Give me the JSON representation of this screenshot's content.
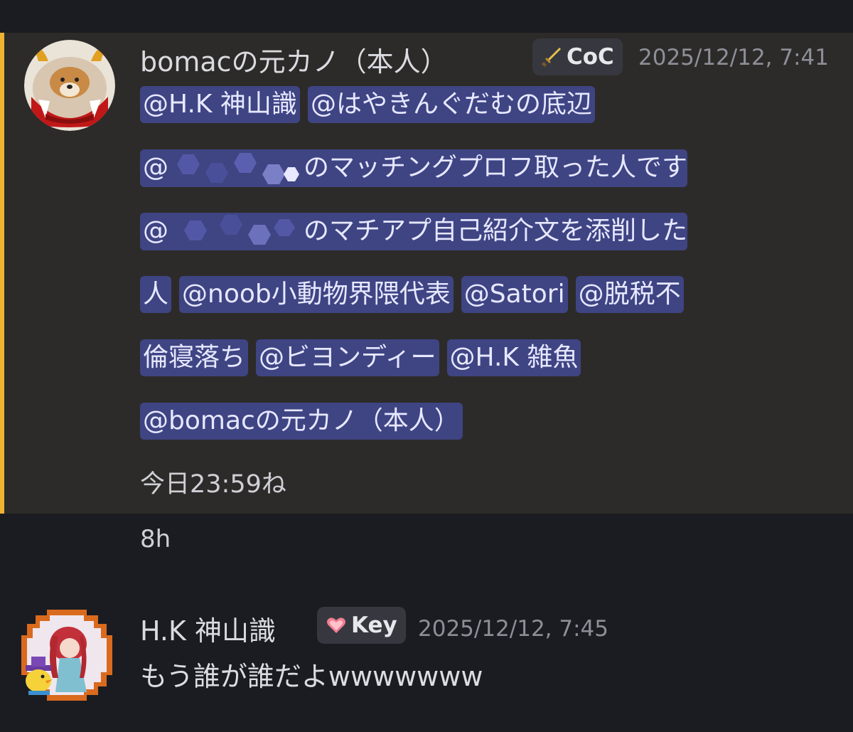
{
  "messages": [
    {
      "author": "bomacの元カノ（本人）",
      "tag": "CoC",
      "tag_icon": "sword-icon",
      "timestamp": "2025/12/12, 7:41",
      "mentions": {
        "m1": "@H.K 神山識",
        "m2": "@はやきんぐだむの底辺",
        "m3_prefix": "@",
        "m3_suffix": "のマッチングプロフ取った人です",
        "m4_prefix": "@",
        "m4_suffix": "のマチアプ自己紹介文を添削した",
        "m4_tail": "人",
        "m5": "@noob小動物界隈代表",
        "m6": "@Satori",
        "m7a": "@脱税不",
        "m7b": "倫寝落ち",
        "m8": "@ビヨンディー",
        "m9": "@H.K 雑魚",
        "m10": "@bomacの元カノ（本人）"
      },
      "text": "今日23:59ね",
      "highlight_color": "#f0b232"
    },
    {
      "relative_time": "8h"
    },
    {
      "author": "H.K 神山識",
      "tag": "Key",
      "tag_icon": "heart-icon",
      "timestamp": "2025/12/12, 7:45",
      "text": "もう誰が誰だよwwwwwww"
    }
  ]
}
